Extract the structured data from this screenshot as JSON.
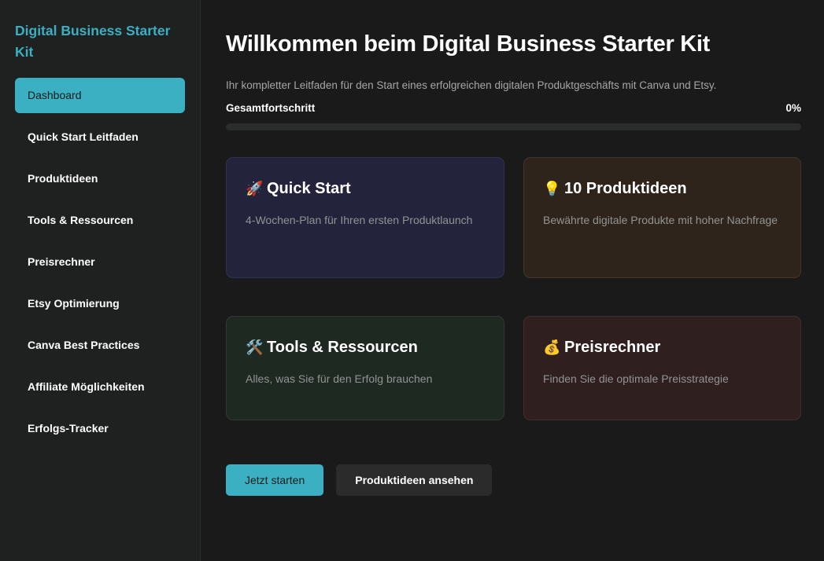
{
  "sidebar": {
    "brand": "Digital Business Starter Kit",
    "items": [
      {
        "label": "Dashboard",
        "active": true
      },
      {
        "label": "Quick Start Leitfaden"
      },
      {
        "label": "Produktideen"
      },
      {
        "label": "Tools & Ressourcen"
      },
      {
        "label": "Preisrechner"
      },
      {
        "label": "Etsy Optimierung"
      },
      {
        "label": "Canva Best Practices"
      },
      {
        "label": "Affiliate Möglichkeiten"
      },
      {
        "label": "Erfolgs-Tracker"
      }
    ]
  },
  "main": {
    "title": "Willkommen beim Digital Business Starter Kit",
    "subtitle": "Ihr kompletter Leitfaden für den Start eines erfolgreichen digitalen Produktgeschäfts mit Canva und Etsy.",
    "progress": {
      "label": "Gesamtfortschritt",
      "value_text": "0%",
      "value": 0
    }
  },
  "cards": [
    {
      "icon": "rocket-icon",
      "glyph": "🚀",
      "title": "Quick Start",
      "desc": "4-Wochen-Plan für Ihren ersten Produktlaunch",
      "color": "#23243c"
    },
    {
      "icon": "lightbulb-icon",
      "glyph": "💡",
      "title": "10 Produktideen",
      "desc": "Bewährte digitale Produkte mit hoher Nachfrage",
      "color": "#2f241b"
    },
    {
      "icon": "tools-icon",
      "glyph": "🛠️",
      "title": "Tools & Ressourcen",
      "desc": "Alles, was Sie für den Erfolg brauchen",
      "color": "#1e2921"
    },
    {
      "icon": "money-bag-icon",
      "glyph": "💰",
      "title": "Preisrechner",
      "desc": "Finden Sie die optimale Preisstrategie",
      "color": "#2f1f1f"
    }
  ],
  "actions": {
    "primary_label": "Jetzt starten",
    "secondary_label": "Produktideen ansehen"
  },
  "colors": {
    "accent": "#3ab0c2",
    "background": "#1a1a1a",
    "sidebar": "#1f2020"
  }
}
